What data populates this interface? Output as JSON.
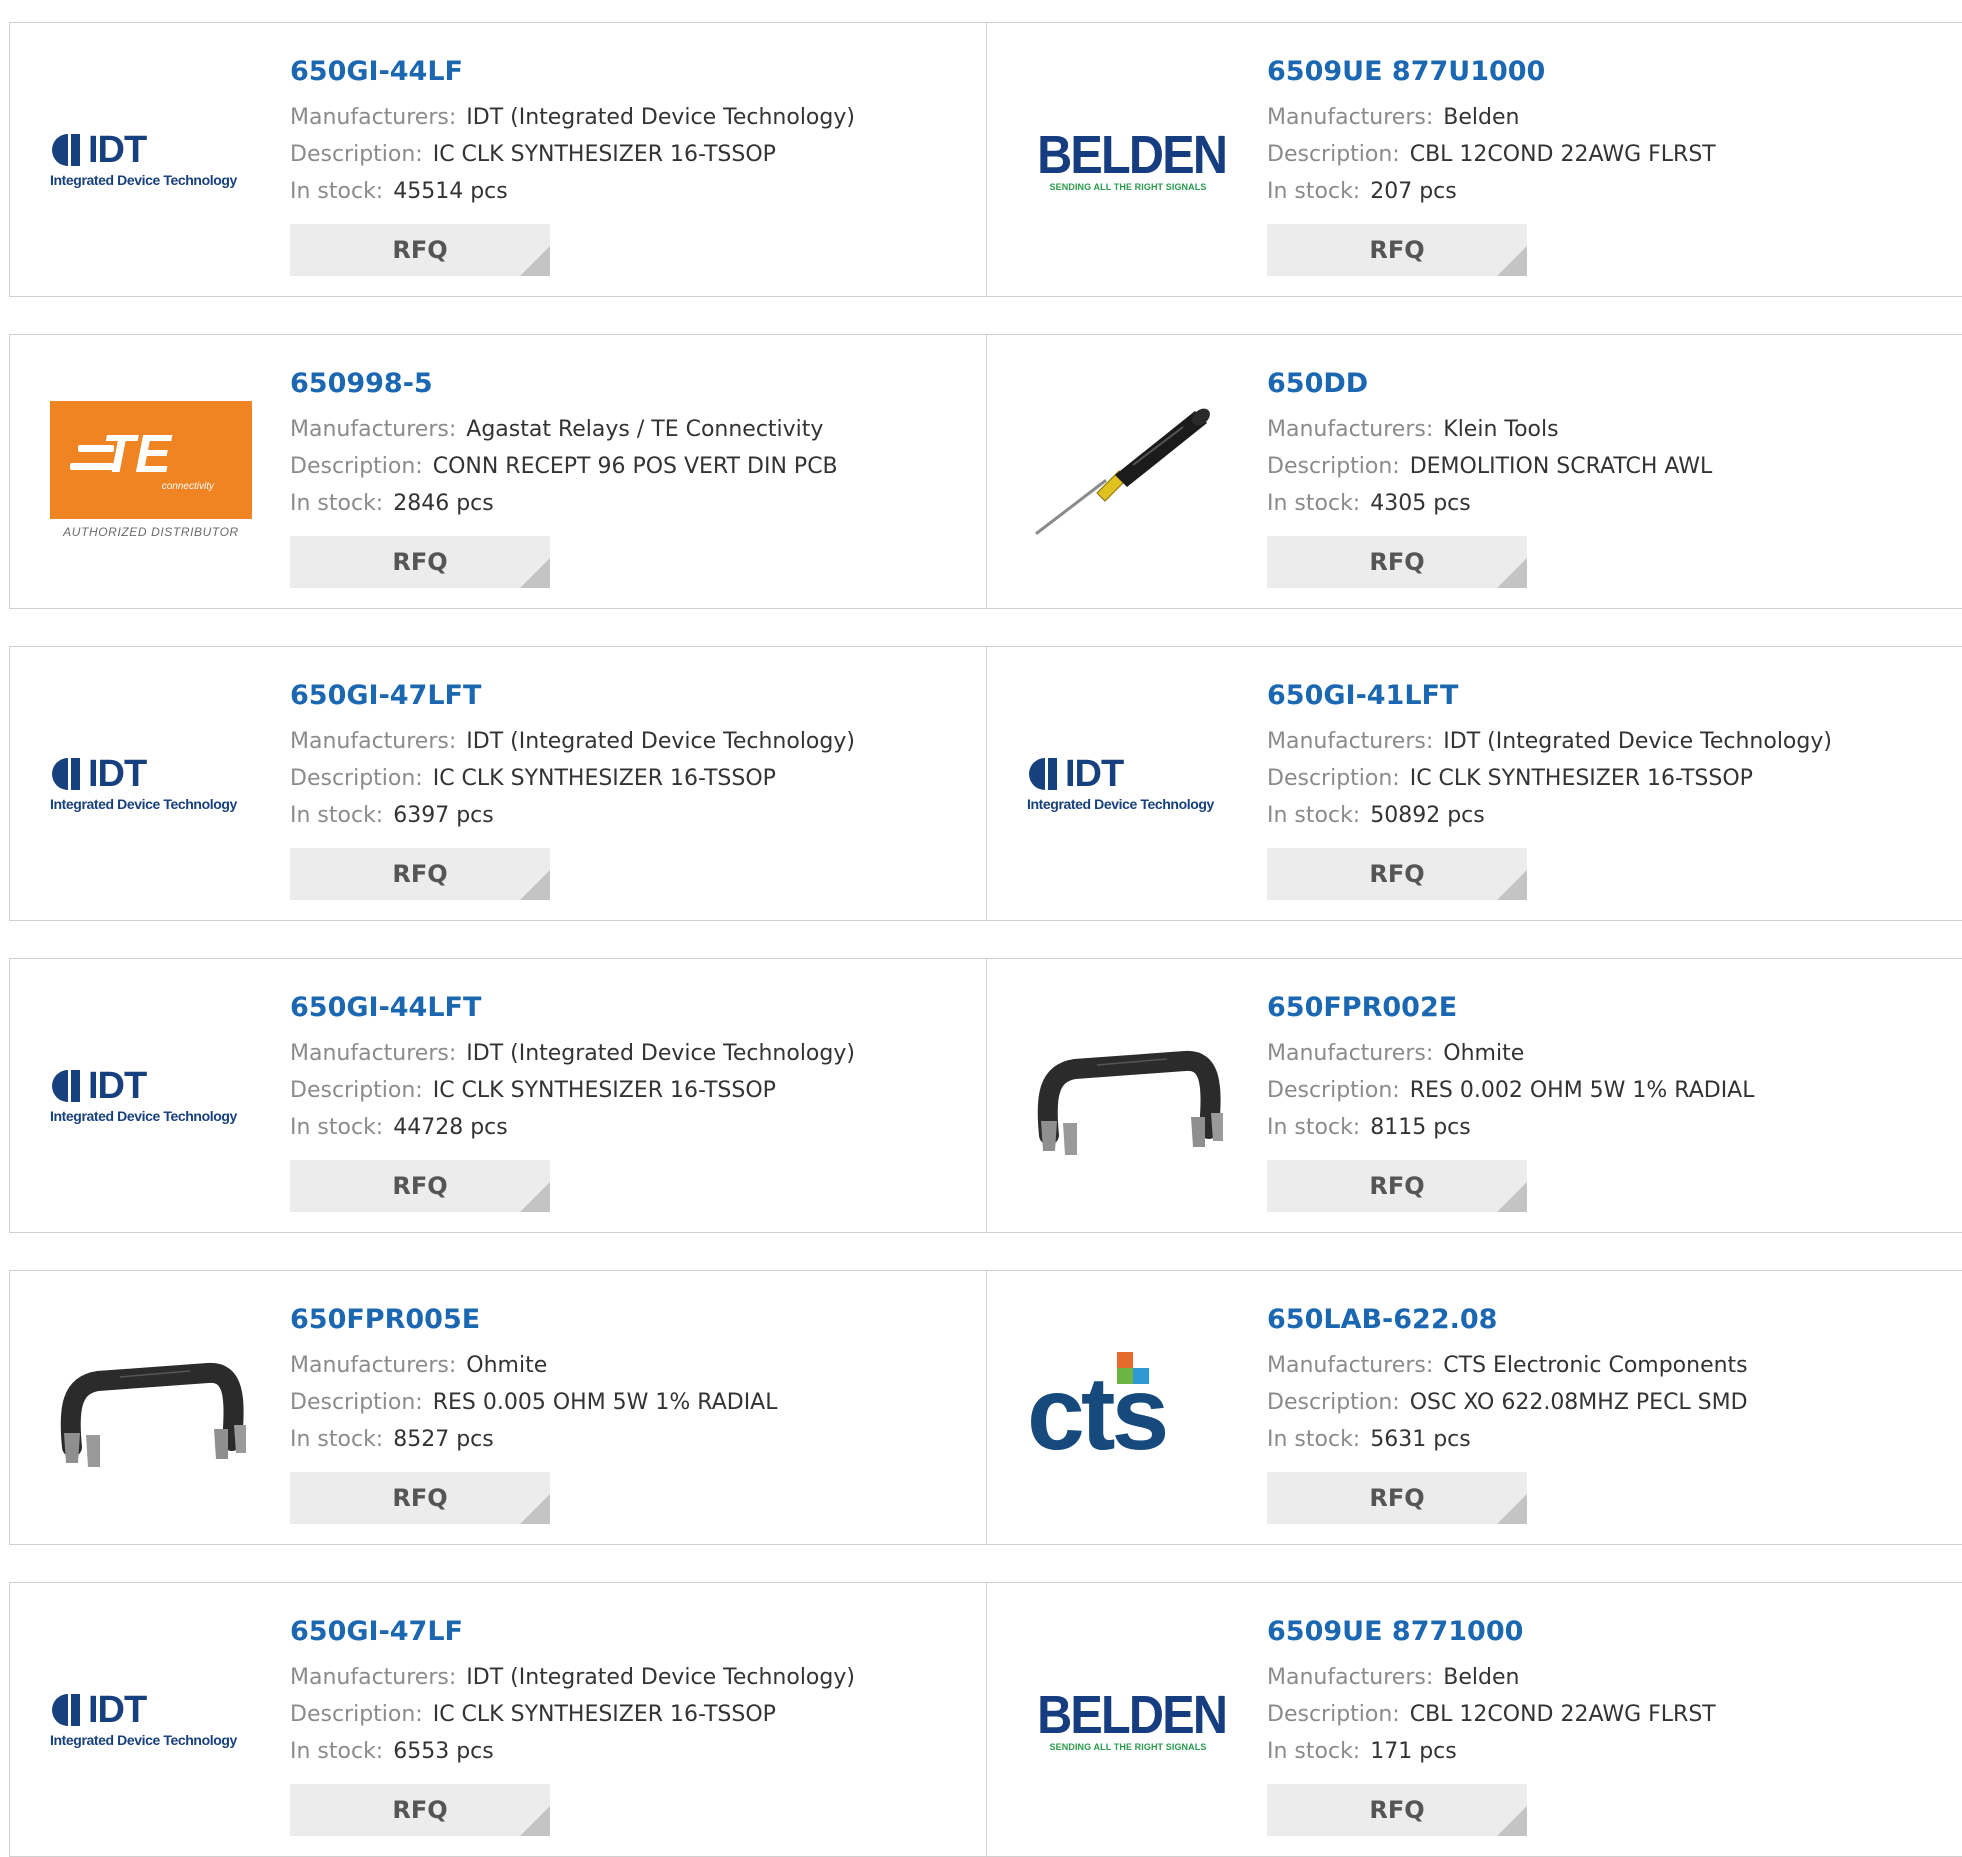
{
  "labels": {
    "manufacturers": "Manufacturers:",
    "description": "Description:",
    "in_stock": "In stock:",
    "rfq": "RFQ"
  },
  "logos": {
    "idt_word": "IDT",
    "idt_tagline": "Integrated Device Technology",
    "belden_word": "BELDEN",
    "belden_tagline": "SENDING ALL THE RIGHT SIGNALS",
    "te_word": "TE",
    "te_sub": "connectivity",
    "te_authorized": "AUTHORIZED DISTRIBUTOR",
    "cts_word": "cts"
  },
  "colors": {
    "part_link": "#1b67b1",
    "label": "#8b8b8b",
    "rfq_bg": "#ececec",
    "te_orange": "#f18422",
    "cts_blue": "#174a7c"
  },
  "products": [
    {
      "part": "650GI-44LF",
      "manufacturer": "IDT (Integrated Device Technology)",
      "description": "IC CLK SYNTHESIZER 16-TSSOP",
      "stock": "45514 pcs",
      "logo": "idt-logo"
    },
    {
      "part": "6509UE 877U1000",
      "manufacturer": "Belden",
      "description": "CBL 12COND 22AWG FLRST",
      "stock": "207 pcs",
      "logo": "belden-logo"
    },
    {
      "part": "650998-5",
      "manufacturer": "Agastat Relays / TE Connectivity",
      "description": "CONN RECEPT 96 POS VERT DIN PCB",
      "stock": "2846 pcs",
      "logo": "te-connectivity-logo"
    },
    {
      "part": "650DD",
      "manufacturer": "Klein Tools",
      "description": "DEMOLITION SCRATCH AWL",
      "stock": "4305 pcs",
      "logo": "scratch-awl-photo"
    },
    {
      "part": "650GI-47LFT",
      "manufacturer": "IDT (Integrated Device Technology)",
      "description": "IC CLK SYNTHESIZER 16-TSSOP",
      "stock": "6397 pcs",
      "logo": "idt-logo"
    },
    {
      "part": "650GI-41LFT",
      "manufacturer": "IDT (Integrated Device Technology)",
      "description": "IC CLK SYNTHESIZER 16-TSSOP",
      "stock": "50892 pcs",
      "logo": "idt-logo"
    },
    {
      "part": "650GI-44LFT",
      "manufacturer": "IDT (Integrated Device Technology)",
      "description": "IC CLK SYNTHESIZER 16-TSSOP",
      "stock": "44728 pcs",
      "logo": "idt-logo"
    },
    {
      "part": "650FPR002E",
      "manufacturer": "Ohmite",
      "description": "RES 0.002 OHM 5W 1% RADIAL",
      "stock": "8115 pcs",
      "logo": "resistor-photo"
    },
    {
      "part": "650FPR005E",
      "manufacturer": "Ohmite",
      "description": "RES 0.005 OHM 5W 1% RADIAL",
      "stock": "8527 pcs",
      "logo": "resistor-photo"
    },
    {
      "part": "650LAB-622.08",
      "manufacturer": "CTS Electronic Components",
      "description": "OSC XO 622.08MHZ PECL SMD",
      "stock": "5631 pcs",
      "logo": "cts-logo"
    },
    {
      "part": "650GI-47LF",
      "manufacturer": "IDT (Integrated Device Technology)",
      "description": "IC CLK SYNTHESIZER 16-TSSOP",
      "stock": "6553 pcs",
      "logo": "idt-logo"
    },
    {
      "part": "6509UE 8771000",
      "manufacturer": "Belden",
      "description": "CBL 12COND 22AWG FLRST",
      "stock": "171 pcs",
      "logo": "belden-logo"
    }
  ]
}
